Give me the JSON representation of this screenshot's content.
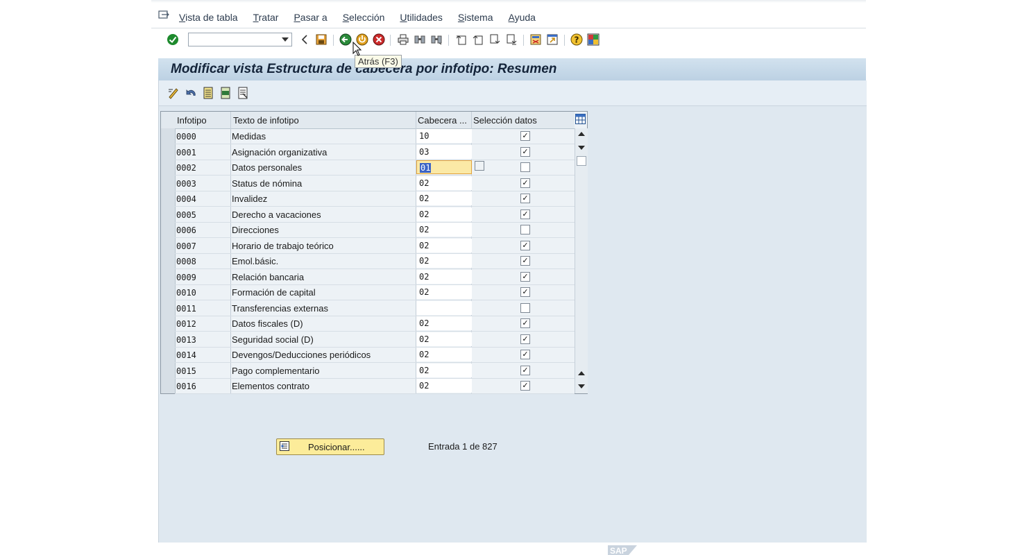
{
  "menu": {
    "items": [
      {
        "u": "V",
        "rest": "ista de tabla"
      },
      {
        "u": "T",
        "rest": "ratar"
      },
      {
        "u": "P",
        "rest": "asar a"
      },
      {
        "u": "S",
        "rest": "elección"
      },
      {
        "u": "U",
        "rest": "tilidades"
      },
      {
        "u": "S",
        "rest": "istema"
      },
      {
        "u": "A",
        "rest": "yuda"
      }
    ]
  },
  "toolbar": {
    "command_value": "",
    "tooltip": "Atrás   (F3)",
    "icons": [
      "enter-icon",
      "command-field",
      "back-arrow-icon",
      "save-icon",
      "back-icon",
      "exit-icon",
      "cancel-icon",
      "print-icon",
      "find-icon",
      "find-next-icon",
      "first-page-icon",
      "previous-page-icon",
      "next-page-icon",
      "last-page-icon",
      "create-session-icon",
      "shortcut-icon",
      "help-icon",
      "layout-icon"
    ]
  },
  "title": "Modificar vista Estructura de cabecera por infotipo: Resumen",
  "app_toolbar": {
    "icons": [
      "display-change-icon",
      "undo-icon",
      "select-all-icon",
      "select-block-icon",
      "deselect-all-icon"
    ]
  },
  "table": {
    "headers": [
      "Infotipo",
      "Texto de infotipo",
      "Cabecera ...",
      "Selección datos"
    ],
    "rows": [
      {
        "code": "0000",
        "text": "Medidas",
        "cab": "10",
        "sel": true
      },
      {
        "code": "0001",
        "text": "Asignación organizativa",
        "cab": "03",
        "sel": true
      },
      {
        "code": "0002",
        "text": "Datos personales",
        "cab": "01",
        "sel": false,
        "active": true
      },
      {
        "code": "0003",
        "text": "Status de nómina",
        "cab": "02",
        "sel": true
      },
      {
        "code": "0004",
        "text": "Invalidez",
        "cab": "02",
        "sel": true
      },
      {
        "code": "0005",
        "text": "Derecho a vacaciones",
        "cab": "02",
        "sel": true
      },
      {
        "code": "0006",
        "text": "Direcciones",
        "cab": "02",
        "sel": false
      },
      {
        "code": "0007",
        "text": "Horario de trabajo teórico",
        "cab": "02",
        "sel": true
      },
      {
        "code": "0008",
        "text": "Emol.básic.",
        "cab": "02",
        "sel": true
      },
      {
        "code": "0009",
        "text": "Relación bancaria",
        "cab": "02",
        "sel": true
      },
      {
        "code": "0010",
        "text": "Formación de capital",
        "cab": "02",
        "sel": true
      },
      {
        "code": "0011",
        "text": "Transferencias externas",
        "cab": "",
        "sel": false
      },
      {
        "code": "0012",
        "text": "Datos fiscales (D)",
        "cab": "02",
        "sel": true
      },
      {
        "code": "0013",
        "text": "Seguridad social (D)",
        "cab": "02",
        "sel": true
      },
      {
        "code": "0014",
        "text": "Devengos/Deducciones periódicos",
        "cab": "02",
        "sel": true
      },
      {
        "code": "0015",
        "text": "Pago complementario",
        "cab": "02",
        "sel": true
      },
      {
        "code": "0016",
        "text": "Elementos contrato",
        "cab": "02",
        "sel": true
      }
    ]
  },
  "position_button": "Posicionar......",
  "entry_status": "Entrada 1 de 827",
  "footer_logo": "SAP"
}
